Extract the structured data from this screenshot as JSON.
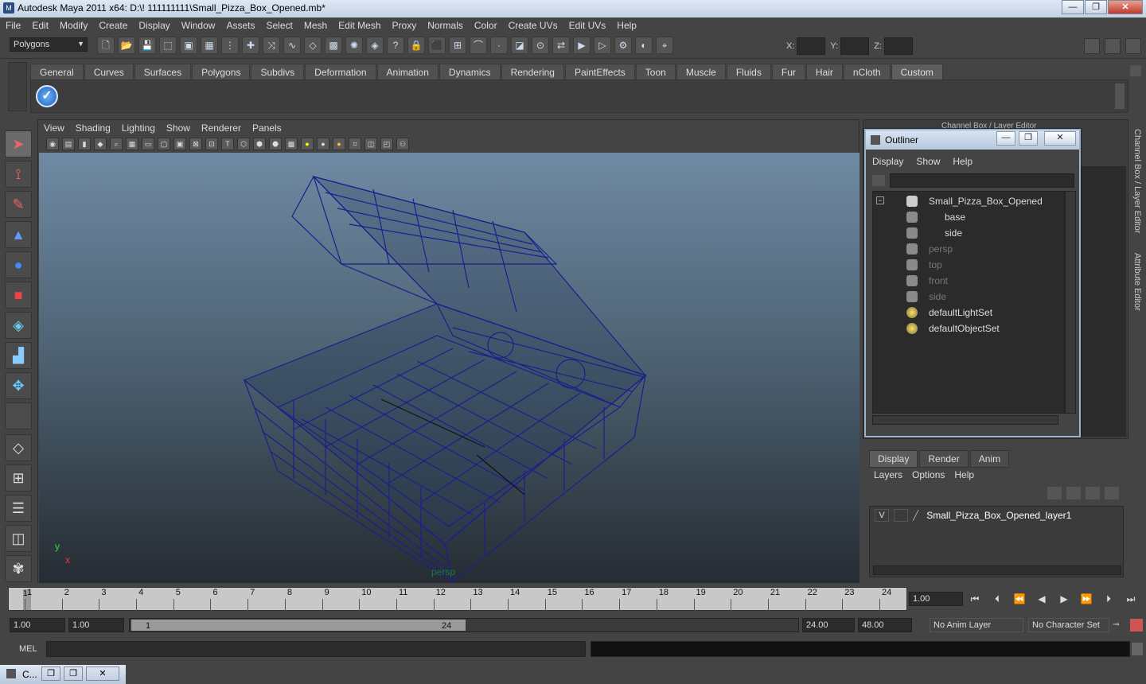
{
  "window": {
    "title": "Autodesk Maya 2011 x64: D:\\! 111111111\\Small_Pizza_Box_Opened.mb*",
    "minimize": "—",
    "maximize": "❐",
    "close": "✕"
  },
  "menubar": [
    "File",
    "Edit",
    "Modify",
    "Create",
    "Display",
    "Window",
    "Assets",
    "Select",
    "Mesh",
    "Edit Mesh",
    "Proxy",
    "Normals",
    "Color",
    "Create UVs",
    "Edit UVs",
    "Help"
  ],
  "toolbar": {
    "mode": "Polygons",
    "x_label": "X:",
    "y_label": "Y:",
    "z_label": "Z:"
  },
  "shelf_tabs": [
    "General",
    "Curves",
    "Surfaces",
    "Polygons",
    "Subdivs",
    "Deformation",
    "Animation",
    "Dynamics",
    "Rendering",
    "PaintEffects",
    "Toon",
    "Muscle",
    "Fluids",
    "Fur",
    "Hair",
    "nCloth",
    "Custom"
  ],
  "shelf_active": "Custom",
  "viewport": {
    "menu": [
      "View",
      "Shading",
      "Lighting",
      "Show",
      "Renderer",
      "Panels"
    ],
    "camera": "persp",
    "axis_x": "x",
    "axis_y": "y"
  },
  "outliner": {
    "title": "Outliner",
    "menu": [
      "Display",
      "Show",
      "Help"
    ],
    "items": [
      {
        "label": "Small_Pizza_Box_Opened",
        "kind": "transform",
        "dim": false,
        "child": false
      },
      {
        "label": "base",
        "kind": "mesh",
        "dim": false,
        "child": true
      },
      {
        "label": "side",
        "kind": "mesh",
        "dim": false,
        "child": true
      },
      {
        "label": "persp",
        "kind": "camera",
        "dim": true,
        "child": false
      },
      {
        "label": "top",
        "kind": "camera",
        "dim": true,
        "child": false
      },
      {
        "label": "front",
        "kind": "camera",
        "dim": true,
        "child": false
      },
      {
        "label": "side",
        "kind": "camera",
        "dim": true,
        "child": false
      },
      {
        "label": "defaultLightSet",
        "kind": "set",
        "dim": false,
        "child": false
      },
      {
        "label": "defaultObjectSet",
        "kind": "set",
        "dim": false,
        "child": false
      }
    ]
  },
  "right_tabs": {
    "channel_box": "Channel Box / Layer Editor",
    "attribute_editor": "Attribute Editor"
  },
  "layer_panel": {
    "tabs": [
      "Display",
      "Render",
      "Anim"
    ],
    "active_tab": "Display",
    "menu": [
      "Layers",
      "Options",
      "Help"
    ],
    "layer": {
      "visible": "V",
      "name": "Small_Pizza_Box_Opened_layer1"
    }
  },
  "timeline": {
    "frames": [
      "1",
      "2",
      "3",
      "4",
      "5",
      "6",
      "7",
      "8",
      "9",
      "10",
      "11",
      "12",
      "13",
      "14",
      "15",
      "16",
      "17",
      "18",
      "19",
      "20",
      "21",
      "22",
      "23",
      "24"
    ],
    "current_frame": "1",
    "current_time": "1.00"
  },
  "range": {
    "start_time": "1.00",
    "playback_start": "1.00",
    "slider_start": "1",
    "slider_end": "24",
    "playback_end": "24.00",
    "end_time": "48.00",
    "anim_layer": "No Anim Layer",
    "character_set": "No Character Set"
  },
  "mel": {
    "label": "MEL"
  },
  "taskbar": {
    "item": "C..."
  }
}
